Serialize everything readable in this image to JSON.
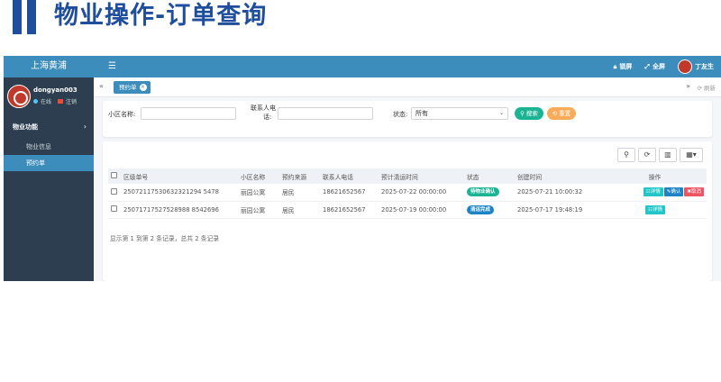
{
  "slide": {
    "title": "物业操作-订单查询"
  },
  "sidebar": {
    "brand": "上海黄浦",
    "user": {
      "name": "dongyan003",
      "status": "在线",
      "logout": "注销"
    },
    "menu_group": "物业功能",
    "items": [
      {
        "label": "物业信息"
      },
      {
        "label": "预约单"
      }
    ]
  },
  "topbar": {
    "lock": "锁屏",
    "fullscreen": "全屏",
    "username": "丁友生"
  },
  "tabs": {
    "active": "预约单",
    "refresh": "刷新"
  },
  "search": {
    "community_label": "小区名称:",
    "community_value": "",
    "phone_label_1": "联系人电",
    "phone_label_2": "话:",
    "phone_value": "",
    "status_label": "状态:",
    "status_value": "所有",
    "search_button": "搜索",
    "reset_button": "重置"
  },
  "table": {
    "headers": [
      "区级单号",
      "小区名称",
      "预约来源",
      "联系人电话",
      "预计清运时间",
      "状态",
      "创建时间",
      "操作"
    ],
    "rows": [
      {
        "order_no": "25072117530632321294 5478",
        "community": "丽园公寓",
        "source": "居民",
        "phone": "18621652567",
        "expected_time": "2025-07-22 00:00:00",
        "status": "待物业确认",
        "created": "2025-07-21 10:00:32",
        "actions": [
          "详情",
          "确认",
          "取消"
        ]
      },
      {
        "order_no": "25071717527528988 8542696",
        "community": "丽园公寓",
        "source": "居民",
        "phone": "18621652567",
        "expected_time": "2025-07-19 00:00:00",
        "status": "清运完成",
        "created": "2025-07-17 19:48:19",
        "actions": [
          "详情"
        ]
      }
    ],
    "summary": "显示第 1 到第 2 条记录，总共 2 条记录"
  }
}
